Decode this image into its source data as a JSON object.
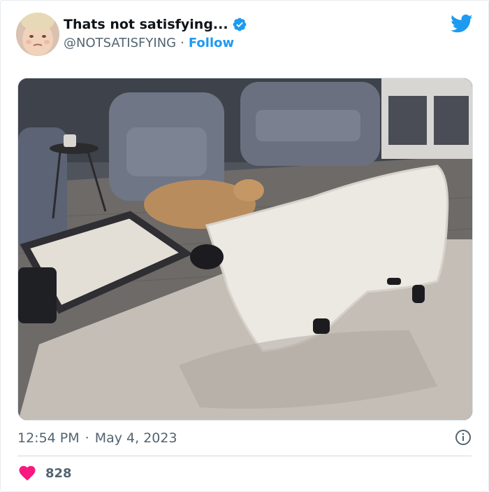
{
  "tweet": {
    "display_name": "Thats not satisfying...",
    "handle": "@NOTSATISFYING",
    "separator": "·",
    "follow_label": "Follow",
    "time": "12:54 PM",
    "date_separator": "·",
    "date": "May 4, 2023",
    "like_count": "828"
  },
  "icons": {
    "verified": "verified-badge-icon",
    "brand": "twitter-bird-icon",
    "info": "info-icon",
    "like": "heart-icon"
  },
  "colors": {
    "accent": "#1d9bf0",
    "heart": "#f91880",
    "secondary_text": "#536471"
  }
}
